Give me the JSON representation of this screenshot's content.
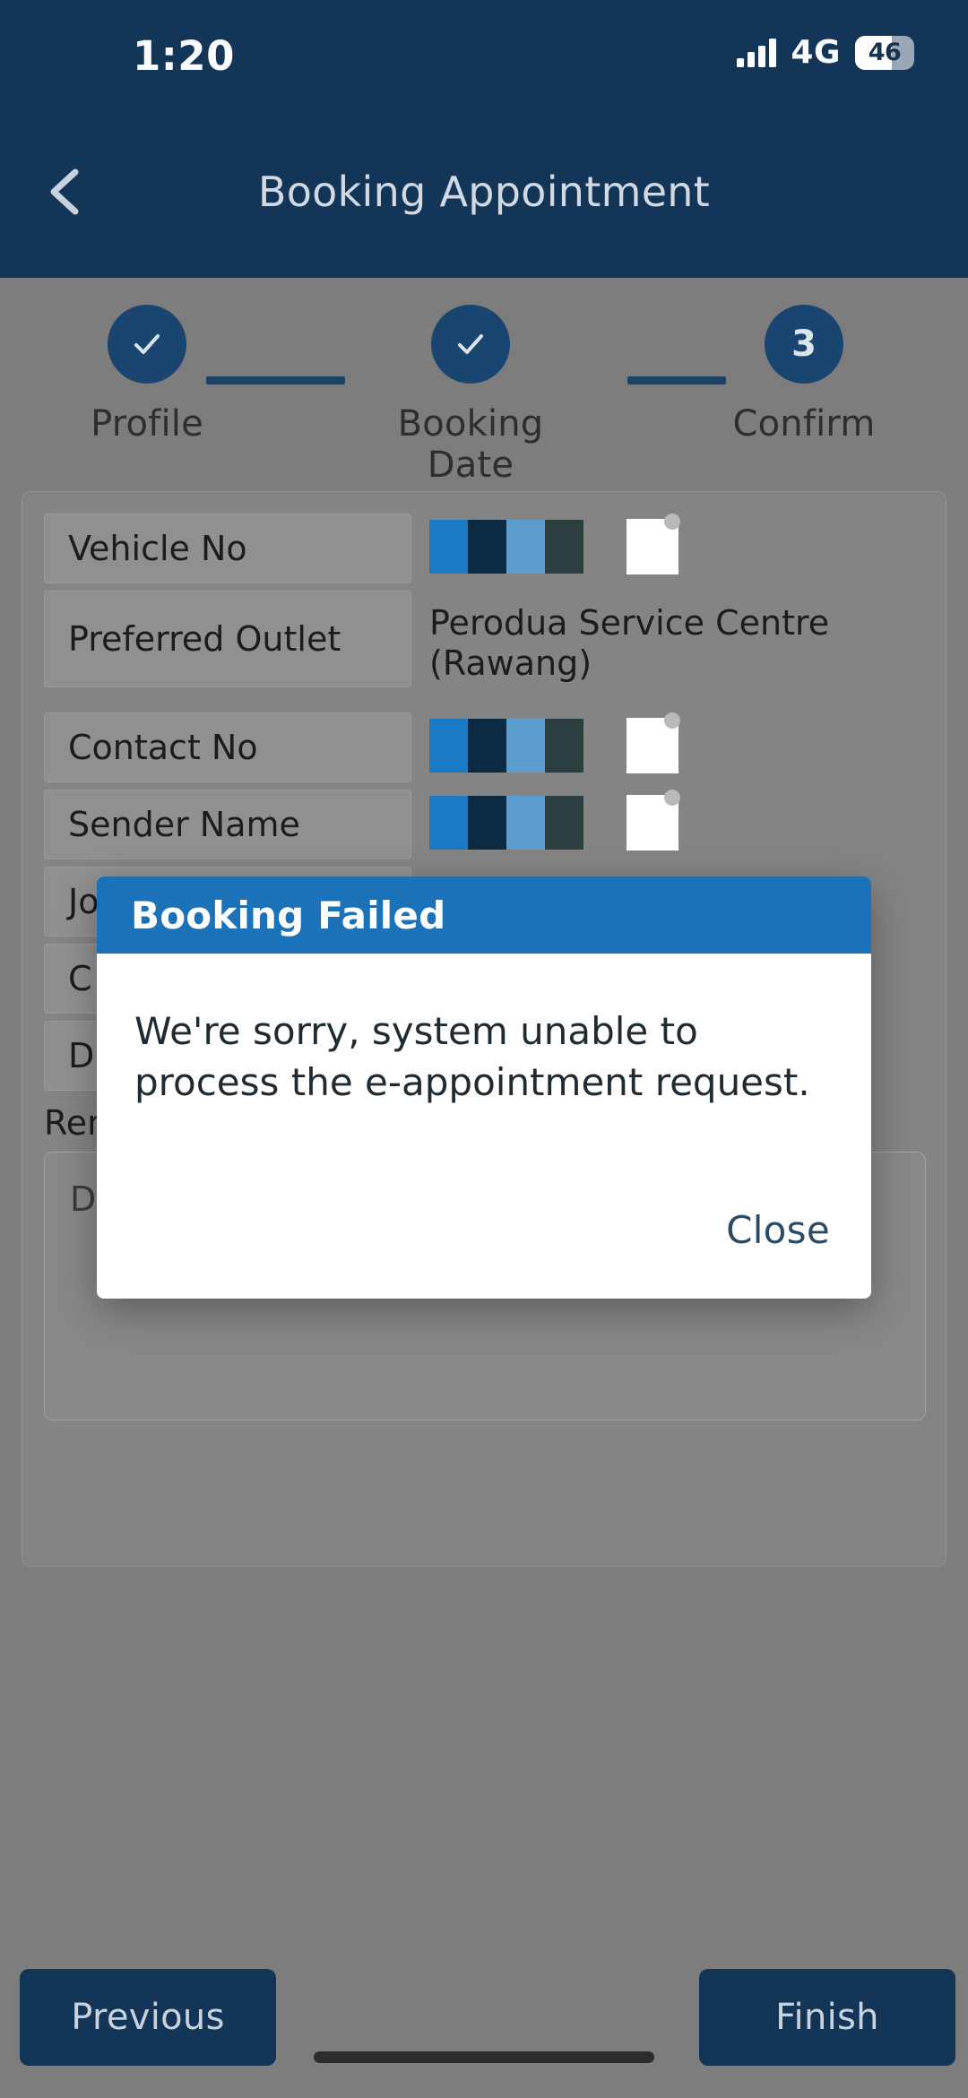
{
  "status_bar": {
    "time": "1:20",
    "network": "4G",
    "battery_level": "46",
    "signal_icon": "signal-bars-icon",
    "battery_icon": "battery-icon"
  },
  "nav": {
    "back_icon": "chevron-left-icon",
    "title": "Booking Appointment"
  },
  "stepper": {
    "steps": [
      {
        "label": "Profile",
        "marker": "✓",
        "state": "completed"
      },
      {
        "label": "Booking Date",
        "marker": "✓",
        "state": "completed"
      },
      {
        "label": "Confirm",
        "marker": "3",
        "state": "current"
      }
    ]
  },
  "form": {
    "rows": [
      {
        "label": "Vehicle No",
        "value": "",
        "redacted": true
      },
      {
        "label": "Preferred Outlet",
        "value": "Perodua Service Centre (Rawang)",
        "redacted": false
      },
      {
        "label": "Contact No",
        "value": "",
        "redacted": true
      },
      {
        "label": "Sender Name",
        "value": "",
        "redacted": true
      },
      {
        "label": "Jo",
        "value": "",
        "redacted": true
      },
      {
        "label": "C",
        "value": "",
        "redacted": true
      },
      {
        "label": "D",
        "value": "",
        "redacted": true
      }
    ],
    "remarks_label": "Rem",
    "remarks_placeholder": "Describe any additional repairs",
    "remarks_value": ""
  },
  "footer": {
    "previous_label": "Previous",
    "finish_label": "Finish"
  },
  "dialog": {
    "title": "Booking Failed",
    "message": "We're sorry, system unable to process the e-appointment request.",
    "close_label": "Close"
  },
  "colors": {
    "header_navy": "#123558",
    "dialog_blue": "#1b72b8",
    "step_bubble": "#1b4571",
    "scrim_grey": "#7d7d7d",
    "action_text": "#2d4a63",
    "redaction_1": "#1b7ac4",
    "redaction_2": "#0b2a44",
    "redaction_3": "#5c9dd0",
    "redaction_4": "#2d3e40"
  }
}
